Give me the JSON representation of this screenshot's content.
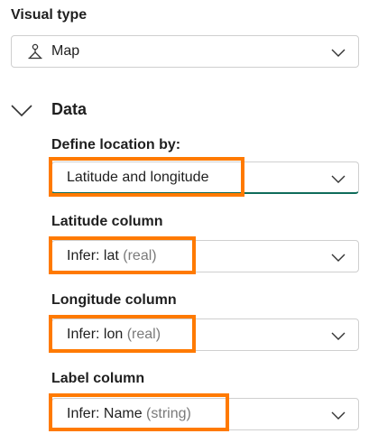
{
  "visual_type": {
    "label": "Visual type",
    "value": "Map",
    "icon": "map-pin-person-icon"
  },
  "data_section": {
    "title": "Data",
    "expanded": true,
    "define_location": {
      "label": "Define location by:",
      "value": "Latitude and longitude"
    },
    "latitude": {
      "label": "Latitude column",
      "value": "Infer: lat",
      "hint": "(real)"
    },
    "longitude": {
      "label": "Longitude column",
      "value": "Infer: lon",
      "hint": "(real)"
    },
    "label_column": {
      "label": "Label column",
      "value": "Infer: Name",
      "hint": "(string)"
    }
  },
  "colors": {
    "highlight": "#ff7a00",
    "focus_underline": "#0f6c5a"
  }
}
